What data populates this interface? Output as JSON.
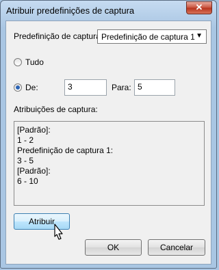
{
  "window": {
    "title": "Atribuir predefinições de captura",
    "close_label": "✕"
  },
  "preset": {
    "label": "Predefinição de captura:",
    "selected": "Predefinição de captura 1"
  },
  "range": {
    "all_label": "Tudo",
    "from_label": "De:",
    "from_value": "3",
    "to_label": "Para:",
    "to_value": "5",
    "selected": "from"
  },
  "assignments": {
    "label": "Atribuições de captura:",
    "lines": [
      "[Padrão]:",
      "1 - 2",
      "Predefinição de captura 1:",
      "3 - 5",
      "[Padrão]:",
      "6 - 10"
    ]
  },
  "buttons": {
    "assign": "Atribuir",
    "ok": "OK",
    "cancel": "Cancelar"
  },
  "icons": {
    "close": "close-icon",
    "dropdown": "chevron-down-icon",
    "cursor": "mouse-pointer-icon"
  }
}
